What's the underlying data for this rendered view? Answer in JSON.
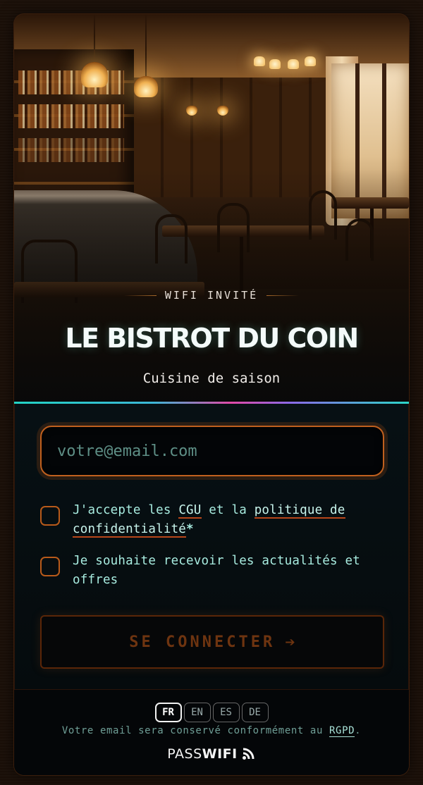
{
  "hero": {
    "eyebrow": "WIFI INVITÉ",
    "title": "LE BISTROT DU COIN",
    "subtitle": "Cuisine de saison"
  },
  "form": {
    "email_placeholder": "votre@email.com",
    "email_value": "",
    "terms": {
      "prefix": "J'accepte les ",
      "cgu_link": "CGU",
      "middle": " et la ",
      "privacy_link": "politique de confidentialité",
      "required_mark": "*",
      "checked": false
    },
    "newsletter": {
      "label": "Je souhaite recevoir les actualités et offres",
      "checked": false
    },
    "connect_label": "SE CONNECTER",
    "connect_arrow": "➔"
  },
  "footer": {
    "languages": [
      "FR",
      "EN",
      "ES",
      "DE"
    ],
    "active_language": "FR",
    "rgpd_prefix": "Votre email sera conservé conformément au ",
    "rgpd_link": "RGPD",
    "rgpd_suffix": ".",
    "brand_light": "PASS",
    "brand_bold": "WIFI",
    "brand_icon": "wifi-icon"
  },
  "colors": {
    "accent_orange": "#c0601e",
    "text_teal": "#9fe3d6",
    "rainbow": [
      "#22d3c4",
      "#e04aa8",
      "#8a6ae8"
    ]
  }
}
